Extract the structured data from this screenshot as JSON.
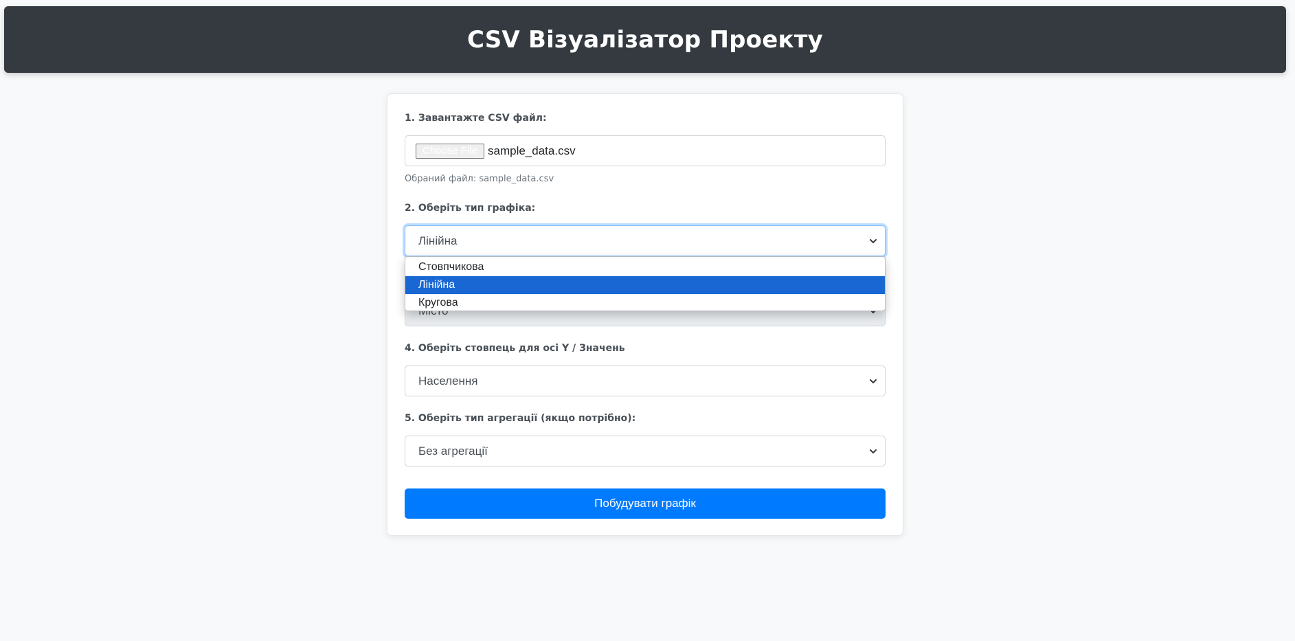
{
  "header": {
    "title": "CSV Візуалізатор Проекту"
  },
  "form": {
    "file": {
      "label": "1. Завантажте CSV файл:",
      "button_label": "Choose File",
      "file_name": "sample_data.csv",
      "help_text": "Обраний файл: sample_data.csv"
    },
    "chart_type": {
      "label": "2. Оберіть тип графіка:",
      "selected": "Лінійна",
      "options": [
        "Стовпчикова",
        "Лінійна",
        "Кругова"
      ],
      "is_open": true
    },
    "x_column": {
      "selected": "Місто"
    },
    "y_column": {
      "label": "4. Оберіть стовпець для осі Y / Значень",
      "selected": "Населення"
    },
    "aggregation": {
      "label": "5. Оберіть тип агрегації (якщо потрібно):",
      "selected": "Без агрегації"
    },
    "submit_label": "Побудувати графік"
  },
  "colors": {
    "header_bg": "#343a40",
    "page_bg": "#f8f9fa",
    "primary": "#007bff",
    "option_highlight": "#1967d2",
    "focus_ring": "#80bdff"
  }
}
